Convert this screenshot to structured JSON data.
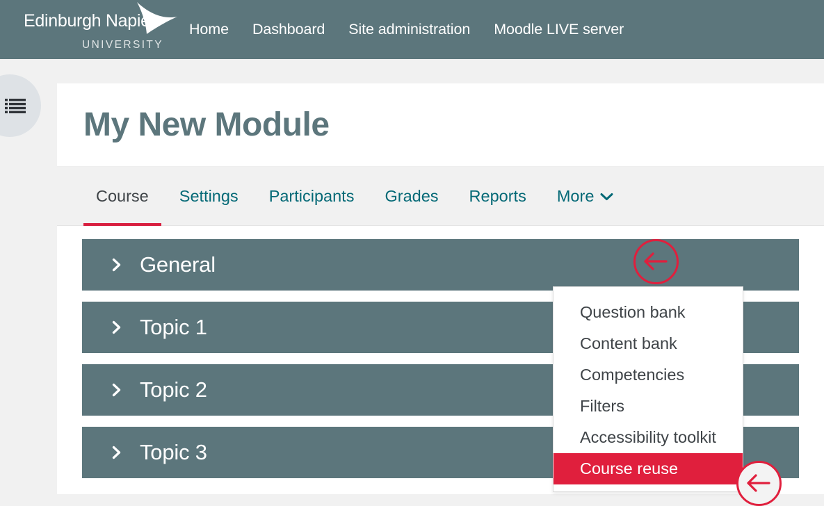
{
  "header": {
    "brand": {
      "name": "Edinburgh Napier",
      "subtitle": "UNIVERSITY",
      "mark_icon": "napier-arrow-logo-icon"
    },
    "nav": [
      {
        "label": "Home",
        "name": "nav-home"
      },
      {
        "label": "Dashboard",
        "name": "nav-dashboard"
      },
      {
        "label": "Site administration",
        "name": "nav-site-administration"
      },
      {
        "label": "Moodle LIVE server",
        "name": "nav-moodle-live-server"
      }
    ]
  },
  "drawer": {
    "toggle_icon": "course-index-list-icon"
  },
  "course": {
    "title": "My New Module",
    "tabs": [
      {
        "label": "Course",
        "name": "tab-course",
        "active": true
      },
      {
        "label": "Settings",
        "name": "tab-settings",
        "active": false
      },
      {
        "label": "Participants",
        "name": "tab-participants",
        "active": false
      },
      {
        "label": "Grades",
        "name": "tab-grades",
        "active": false
      },
      {
        "label": "Reports",
        "name": "tab-reports",
        "active": false
      },
      {
        "label": "More",
        "name": "tab-more",
        "active": false,
        "chevron": "⌄"
      }
    ],
    "sections": [
      {
        "label": "General",
        "name": "section-general"
      },
      {
        "label": "Topic 1",
        "name": "section-topic-1"
      },
      {
        "label": "Topic 2",
        "name": "section-topic-2"
      },
      {
        "label": "Topic 3",
        "name": "section-topic-3"
      }
    ],
    "section_toggle_icon": "chevron-right-icon"
  },
  "more_menu": {
    "items": [
      {
        "label": "Question bank",
        "name": "menu-item-question-bank",
        "highlighted": false
      },
      {
        "label": "Content bank",
        "name": "menu-item-content-bank",
        "highlighted": false
      },
      {
        "label": "Competencies",
        "name": "menu-item-competencies",
        "highlighted": false
      },
      {
        "label": "Filters",
        "name": "menu-item-filters",
        "highlighted": false
      },
      {
        "label": "Accessibility toolkit",
        "name": "menu-item-accessibility-toolkit",
        "highlighted": false
      },
      {
        "label": "Course reuse",
        "name": "menu-item-course-reuse",
        "highlighted": true
      }
    ]
  },
  "annotations": [
    {
      "name": "annotation-arrow-more-tab",
      "icon": "arrow-left-circle-icon"
    },
    {
      "name": "annotation-arrow-course-reuse",
      "icon": "arrow-left-circle-icon"
    }
  ],
  "colors": {
    "brand_slate": "#5c767c",
    "accent_red": "#e01f3d",
    "tab_link_teal": "#046976",
    "page_background": "#f1f1f1",
    "card_background": "#ffffff"
  }
}
